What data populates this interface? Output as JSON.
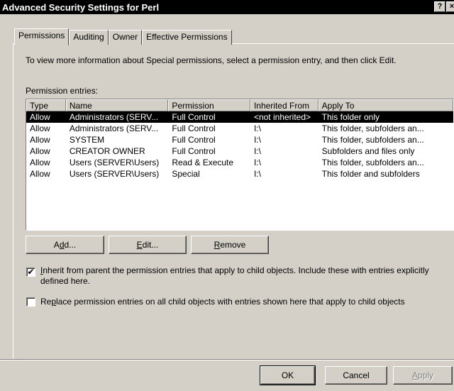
{
  "window": {
    "title": "Advanced Security Settings for Perl",
    "help_glyph": "?",
    "close_glyph": "×"
  },
  "tabs": [
    {
      "label": "Permissions",
      "active": true
    },
    {
      "label": "Auditing",
      "active": false
    },
    {
      "label": "Owner",
      "active": false
    },
    {
      "label": "Effective Permissions",
      "active": false
    }
  ],
  "info_text": "To view more information about Special permissions, select a permission entry, and then click Edit.",
  "entries_label": "Permission entries:",
  "columns": {
    "type": "Type",
    "name": "Name",
    "permission": "Permission",
    "inherited_from": "Inherited From",
    "apply_to": "Apply To"
  },
  "rows": [
    {
      "type": "Allow",
      "name": "Administrators (SERV...",
      "permission": "Full Control",
      "inherited_from": "<not inherited>",
      "apply_to": "This folder only"
    },
    {
      "type": "Allow",
      "name": "Administrators (SERV...",
      "permission": "Full Control",
      "inherited_from": "I:\\",
      "apply_to": "This folder, subfolders an..."
    },
    {
      "type": "Allow",
      "name": "SYSTEM",
      "permission": "Full Control",
      "inherited_from": "I:\\",
      "apply_to": "This folder, subfolders an..."
    },
    {
      "type": "Allow",
      "name": "CREATOR OWNER",
      "permission": "Full Control",
      "inherited_from": "I:\\",
      "apply_to": "Subfolders and files only"
    },
    {
      "type": "Allow",
      "name": "Users (SERVER\\Users)",
      "permission": "Read & Execute",
      "inherited_from": "I:\\",
      "apply_to": "This folder, subfolders an..."
    },
    {
      "type": "Allow",
      "name": "Users (SERVER\\Users)",
      "permission": "Special",
      "inherited_from": "I:\\",
      "apply_to": "This folder and subfolders"
    }
  ],
  "buttons": {
    "add": {
      "pre": "A",
      "key": "d",
      "post": "d..."
    },
    "edit": {
      "pre": "",
      "key": "E",
      "post": "dit..."
    },
    "remove": {
      "pre": "",
      "key": "R",
      "post": "emove"
    },
    "ok": "OK",
    "cancel": "Cancel",
    "apply": {
      "pre": "",
      "key": "A",
      "post": "pply"
    }
  },
  "checkboxes": {
    "inherit": {
      "checked": true,
      "key": "I",
      "line1_rest": "nherit from parent the permission entries that apply to child objects. Include these with entries explicitly",
      "line2": "defined here."
    },
    "replace": {
      "checked": false,
      "pre": "Re",
      "key": "p",
      "rest": "lace permission entries on all child objects with entries shown here that apply to child objects"
    }
  }
}
